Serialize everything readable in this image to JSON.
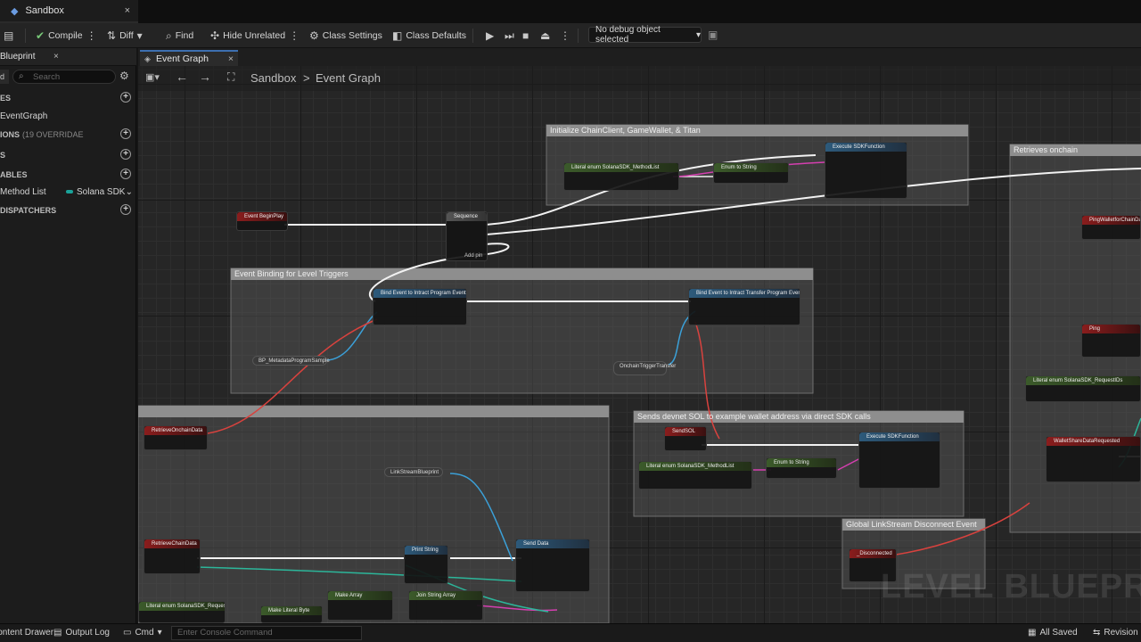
{
  "window": {
    "title": "Sandbox",
    "close": "×"
  },
  "toolbar": {
    "compile": "Compile",
    "diff": "Diff",
    "find": "Find",
    "hide_unrelated": "Hide Unrelated",
    "class_settings": "Class Settings",
    "class_defaults": "Class Defaults",
    "debug_object": "No debug object selected"
  },
  "sidebar": {
    "tab": "Blueprint",
    "search_placeholder": "Search",
    "d": "d",
    "sections": [
      {
        "label": "ES"
      },
      {
        "label": "EventGraph"
      },
      {
        "label": "IONS",
        "suffix": "(19 OVERRIDAE"
      },
      {
        "label": "S"
      },
      {
        "label": "ABLES"
      },
      {
        "label": "Method List",
        "type": "Solana SDK"
      },
      {
        "label": "DISPATCHERS"
      }
    ]
  },
  "graph": {
    "tab": "Event Graph",
    "breadcrumb_root": "Sandbox",
    "breadcrumb_sep": ">",
    "breadcrumb_current": "Event Graph",
    "watermark": "LEVEL BLUEPRINT",
    "comments": {
      "init": "Initialize ChainClient, GameWallet, & Titan",
      "retrieve_onchain": "Retrieves onchain",
      "event_binding": "Event Binding for Level Triggers",
      "send_devnet": "Sends devnet SOL to example wallet address via direct SDK calls",
      "linkstream": "Global LinkStream Disconnect Event"
    },
    "nodes": {
      "event_beginplay": "Event BeginPlay",
      "sequence": "Sequence",
      "add_pin": "Add pin",
      "literal_enum": "Literal enum SolanaSDK_MethodList",
      "enum_to_string": "Enum to String",
      "execute_sdk": "Execute SDKFunction",
      "ping_wallet": "PingWalletforChainData",
      "ping": "Ping",
      "bind_intract_program": "Bind Event to Intract Program Event",
      "bind_intract_transfer": "Bind Event to Intract Transfer Program Event",
      "bp_metadata": "BP_MetadataProgramSample",
      "onchain_trigger": "OnchainTriggerTransfer",
      "retrieve_onchain_data": "RetrieveOnchainData",
      "send_sol": "SendSOL",
      "wallet_share": "WalletShareDataRequested",
      "link_stream": "LinkStreamBlueprint",
      "retrieve_chain_data": "RetrieveChainData",
      "print_string": "Print String",
      "send_data": "Send Data",
      "disconnected": "_Disconnected",
      "make_array": "Make Array",
      "join_string_array": "Join String Array",
      "make_literal_byte": "Make Literal Byte",
      "request_ids": "Literal enum SolanaSDK_RequestIDs"
    }
  },
  "status": {
    "content_drawer": "Content Drawer",
    "output_log": "Output Log",
    "cmd": "Cmd",
    "console_placeholder": "Enter Console Command",
    "all_saved": "All Saved",
    "revision": "Revision"
  }
}
